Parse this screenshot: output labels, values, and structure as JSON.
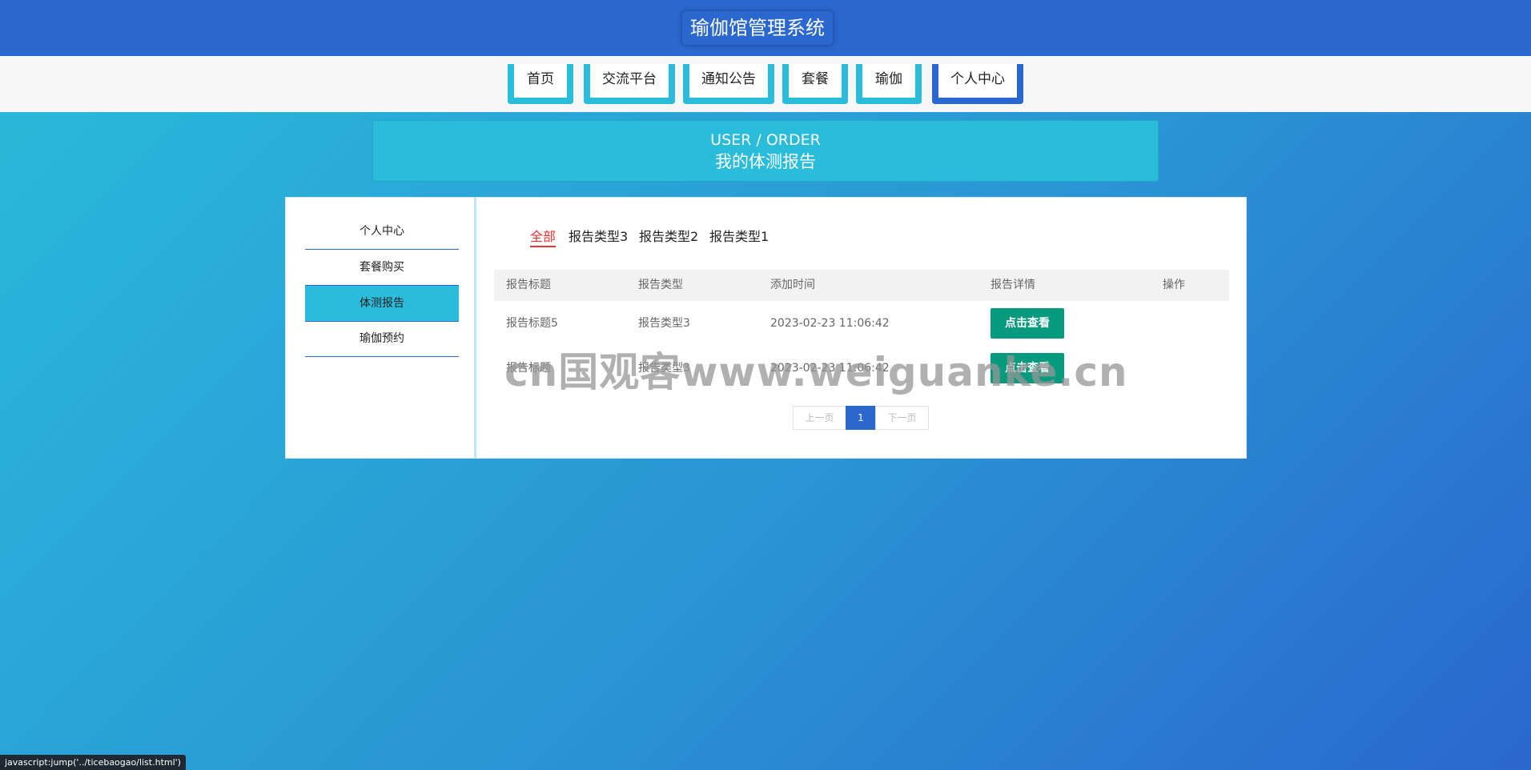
{
  "header": {
    "title": "瑜伽馆管理系统"
  },
  "nav": {
    "items": [
      {
        "label": "首页"
      },
      {
        "label": "交流平台"
      },
      {
        "label": "通知公告"
      },
      {
        "label": "套餐"
      },
      {
        "label": "瑜伽"
      },
      {
        "label": "个人中心",
        "active": true
      }
    ]
  },
  "banner": {
    "en": "USER / ORDER",
    "zh": "我的体测报告"
  },
  "sidebar": {
    "items": [
      {
        "label": "个人中心"
      },
      {
        "label": "套餐购买"
      },
      {
        "label": "体测报告",
        "active": true
      },
      {
        "label": "瑜伽预约"
      }
    ]
  },
  "tabs": [
    {
      "label": "全部",
      "active": true
    },
    {
      "label": "报告类型3"
    },
    {
      "label": "报告类型2"
    },
    {
      "label": "报告类型1"
    }
  ],
  "table": {
    "headers": [
      "报告标题",
      "报告类型",
      "添加时间",
      "报告详情",
      "操作"
    ],
    "rows": [
      {
        "title": "报告标题5",
        "type": "报告类型3",
        "time": "2023-02-23 11:06:42",
        "detail": "点击查看"
      },
      {
        "title": "报告标题",
        "type": "报告类型3",
        "time": "2023-02-23 11:06:42",
        "detail": "点击查看"
      }
    ]
  },
  "pagination": {
    "prev": "上一页",
    "current": "1",
    "next": "下一页"
  },
  "watermark": "cn国观客www.weiguanke.cn",
  "status_bar": "javascript:jump('../ticebaogao/list.html')",
  "colors": {
    "primary": "#2a68cf",
    "accent": "#29bcdb",
    "button": "#079a7e",
    "active_tab": "#e33333"
  }
}
